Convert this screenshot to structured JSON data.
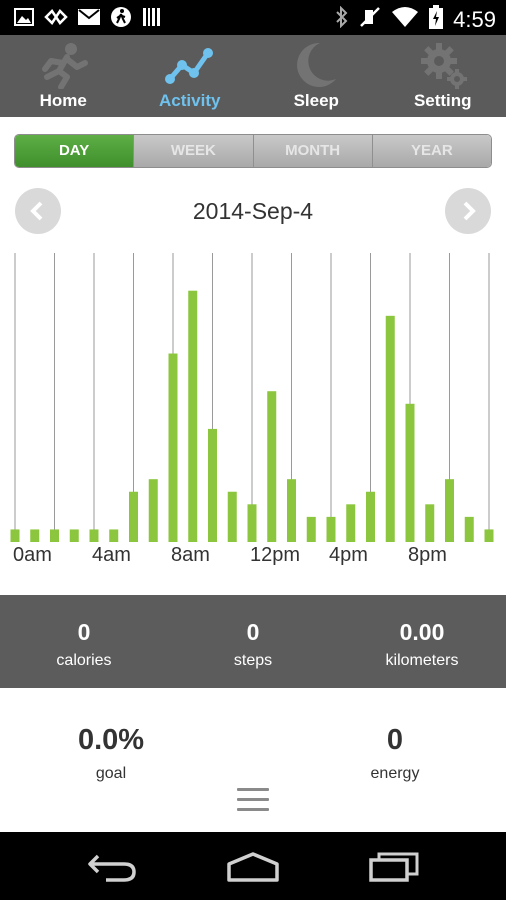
{
  "status_bar": {
    "time": "4:59",
    "left_icons": [
      "image-icon",
      "usb-icon",
      "mail-icon",
      "walking-icon",
      "barcode-icon"
    ],
    "right_icons": [
      "bluetooth-icon",
      "mute-icon",
      "wifi-icon",
      "battery-icon"
    ]
  },
  "nav": {
    "tabs": [
      {
        "label": "Home",
        "icon": "running-man-icon"
      },
      {
        "label": "Activity",
        "icon": "activity-graph-icon",
        "active": true
      },
      {
        "label": "Sleep",
        "icon": "moon-icon"
      },
      {
        "label": "Setting",
        "icon": "gear-icon"
      }
    ],
    "active_color": "#6fc2ee"
  },
  "period": {
    "options": [
      "DAY",
      "WEEK",
      "MONTH",
      "YEAR"
    ],
    "selected": "DAY",
    "accent": "#4c9c36"
  },
  "date": {
    "label": "2014-Sep-4"
  },
  "chart_data": {
    "type": "bar",
    "x_tick_labels": [
      "0am",
      "4am",
      "8am",
      "12pm",
      "4pm",
      "8pm"
    ],
    "categories": [
      "0",
      "1",
      "2",
      "3",
      "4",
      "5",
      "6",
      "7",
      "8",
      "9",
      "10",
      "11",
      "12",
      "13",
      "14",
      "15",
      "16",
      "17",
      "18",
      "19",
      "20",
      "21",
      "22",
      "23",
      "24"
    ],
    "values": [
      1,
      1,
      1,
      1,
      1,
      1,
      4,
      5,
      15,
      20,
      9,
      4,
      3,
      12,
      5,
      2,
      2,
      3,
      4,
      18,
      11,
      3,
      5,
      2,
      1
    ],
    "bar_color": "#8cc63f",
    "grid": "vertical"
  },
  "stats": [
    {
      "value": "0",
      "label": "calories"
    },
    {
      "value": "0",
      "label": "steps"
    },
    {
      "value": "0.00",
      "label": "kilometers"
    }
  ],
  "summary": {
    "goal": {
      "value": "0.0%",
      "label": "goal"
    },
    "energy": {
      "value": "0",
      "label": "energy"
    }
  },
  "system_nav": [
    "back-icon",
    "home-icon",
    "recents-icon"
  ]
}
